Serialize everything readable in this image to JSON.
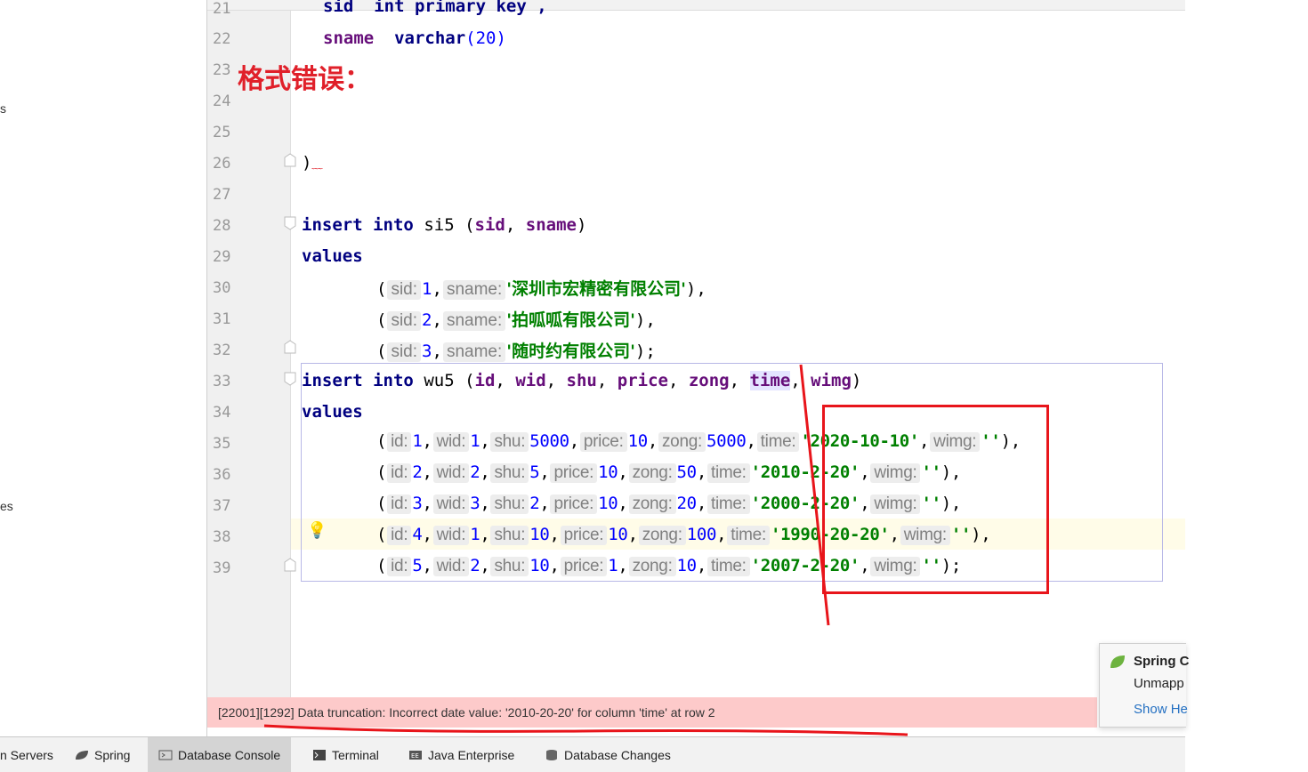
{
  "left_panel": {
    "frag1": "s",
    "frag2": "es"
  },
  "editor": {
    "line_numbers": [
      "21",
      "22",
      "23",
      "24",
      "25",
      "26",
      "27",
      "28",
      "29",
      "30",
      "31",
      "32",
      "33",
      "34",
      "35",
      "36",
      "37",
      "38",
      "39"
    ],
    "annotation": "格式错误：",
    "line21": "sid  int primary key ,",
    "line22": {
      "name": "sname",
      "type": "varchar",
      "size": "(20)"
    },
    "line26": ")",
    "line28": {
      "kw1": "insert",
      "kw2": "into",
      "table": "si5",
      "open": "(",
      "c1": "sid",
      "sep": ",",
      "c2": "sname",
      "close": ")"
    },
    "values_kw": "values",
    "si5_rows": [
      {
        "sid": "1",
        "sname": "'深圳市宏精密有限公司'",
        "end": "),"
      },
      {
        "sid": "2",
        "sname": "'拍呱呱有限公司'",
        "end": "),"
      },
      {
        "sid": "3",
        "sname": "'随时约有限公司'",
        "end": ");"
      }
    ],
    "line33": {
      "kw1": "insert",
      "kw2": "into",
      "table": "wu5",
      "cols": [
        "id",
        "wid",
        "shu",
        "price",
        "zong",
        "time",
        "wimg"
      ]
    },
    "hints": {
      "sid": "sid:",
      "sname": "sname:",
      "id": "id:",
      "wid": "wid:",
      "shu": "shu:",
      "price": "price:",
      "zong": "zong:",
      "time": "time:",
      "wimg": "wimg:"
    },
    "wu5_rows": [
      {
        "id": "1",
        "wid": "1",
        "shu": "5000",
        "price": "10",
        "zong": "5000",
        "time": "'2020-10-10'",
        "wimg": "''",
        "end": "),"
      },
      {
        "id": "2",
        "wid": "2",
        "shu": "5",
        "price": "10",
        "zong": "50",
        "time": "'2010-2-20'",
        "wimg": "''",
        "end": "),"
      },
      {
        "id": "3",
        "wid": "3",
        "shu": "2",
        "price": "10",
        "zong": "20",
        "time": "'2000-2-20'",
        "wimg": "''",
        "end": "),"
      },
      {
        "id": "4",
        "wid": "1",
        "shu": "10",
        "price": "10",
        "zong": "100",
        "time": "'1990-20-20'",
        "wimg": "''",
        "end": "),"
      },
      {
        "id": "5",
        "wid": "2",
        "shu": "10",
        "price": "1",
        "zong": "10",
        "time": "'2007-2-20'",
        "wimg": "''",
        "end": ");"
      }
    ]
  },
  "error": "[22001][1292] Data truncation: Incorrect date value: '2010-20-20' for column 'time' at row 2",
  "bottom_tabs": [
    {
      "label": "n Servers",
      "icon": "servers-icon"
    },
    {
      "label": "Spring",
      "icon": "spring-leaf-icon"
    },
    {
      "label": "Database Console",
      "icon": "console-icon",
      "active": true
    },
    {
      "label": "Terminal",
      "icon": "terminal-icon"
    },
    {
      "label": "Java Enterprise",
      "icon": "java-enterprise-icon"
    },
    {
      "label": "Database Changes",
      "icon": "database-icon"
    }
  ],
  "notification": {
    "title": "Spring C",
    "body": "Unmapp",
    "link": "Show He"
  },
  "colors": {
    "error_bg": "#fdcaca",
    "annotation_red": "#e0202a",
    "keyword": "#000080",
    "string": "#008000",
    "number": "#0000ff"
  }
}
